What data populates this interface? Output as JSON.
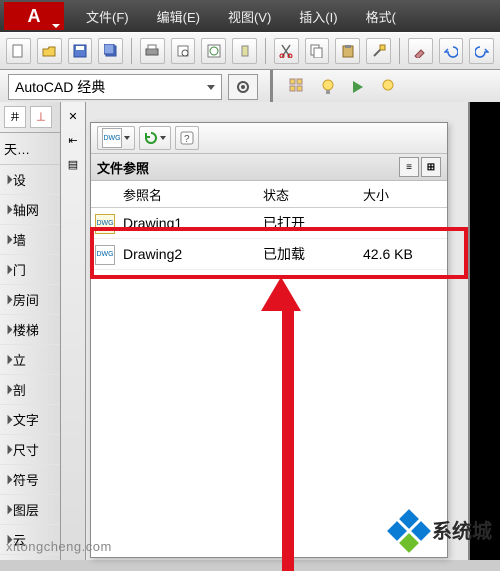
{
  "logo_text": "A",
  "menu": [
    "文件(F)",
    "编辑(E)",
    "视图(V)",
    "插入(I)",
    "格式("
  ],
  "workspace": {
    "label": "AutoCAD 经典"
  },
  "left_panel": {
    "title": "天…",
    "items": [
      "设",
      "轴网",
      "墙",
      "门",
      "房间",
      "楼梯",
      "立",
      "剖",
      "文字",
      "尺寸",
      "符号",
      "图层",
      "云"
    ]
  },
  "xref_panel": {
    "title": "文件参照",
    "columns": {
      "name": "参照名",
      "status": "状态",
      "size": "大小"
    },
    "rows": [
      {
        "name": "Drawing1",
        "status": "已打开",
        "size": ""
      },
      {
        "name": "Drawing2",
        "status": "已加载",
        "size": "42.6 KB"
      }
    ]
  },
  "watermark": {
    "text": "系统城",
    "url": "xitongcheng.com"
  },
  "icons": {
    "new": "new-icon",
    "open": "open-icon",
    "save": "save-icon",
    "saveas": "saveas-icon",
    "print": "print-icon",
    "preview": "preview-icon",
    "publish": "publish-icon",
    "tools": "tools-icon",
    "cut": "cut-icon",
    "copy": "copy-icon",
    "paste": "paste-icon",
    "match": "match-icon",
    "brush": "brush-icon",
    "undo": "undo-icon",
    "redo": "redo-icon",
    "gear": "gear-icon",
    "grid": "grid-icon",
    "bulb": "bulb-icon",
    "play": "play-icon",
    "refresh": "refresh-icon",
    "help": "help-icon",
    "attach": "attach-icon",
    "close": "close-icon",
    "pin": "pin-icon",
    "props": "props-icon"
  }
}
